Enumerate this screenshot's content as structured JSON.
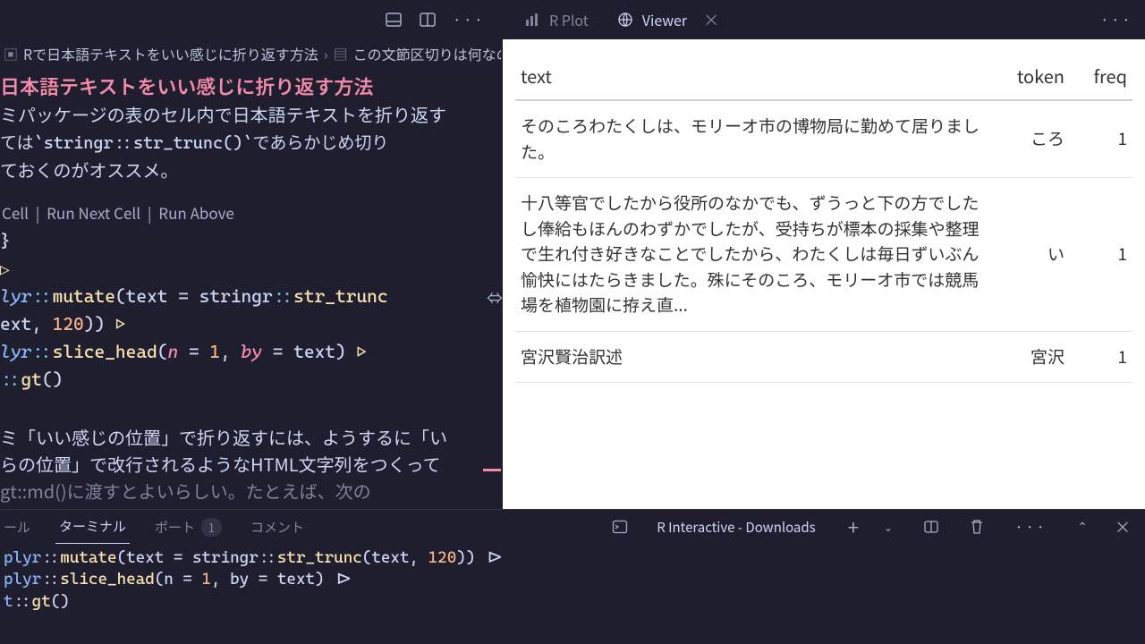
{
  "topbar": {
    "tabs": {
      "rplot": "R Plot",
      "viewer": "Viewer"
    }
  },
  "breadcrumb": {
    "file": "Rで日本語テキストをいい感じに折り返す方法",
    "section": "この文節区切りは何なの"
  },
  "doc": {
    "title": "日本語テキストをいい感じに折り返す方法",
    "p1a": "ミパッケージの表のセル内で日本語テキストを折り返す",
    "p1b": "ては`stringr::str_trunc()`であらかじめ切り",
    "p1c": "ておくのがオススメ。",
    "codelens": {
      "cell": "Cell",
      "next": "Run Next Cell",
      "above": "Run Above"
    },
    "code": {
      "l1": "}",
      "pipe": "▷",
      "l3a": "lyr",
      "l3ns": "::",
      "l3fn": "mutate",
      "l3b": "(text = stringr",
      "l3fn2": "str_trunc",
      "l4a": "ext, ",
      "l4num": "120",
      "l4b": ")) ",
      "l5a": "lyr",
      "l5fn": "slice_head",
      "l5b": "(",
      "l5p1": "n",
      "l5c": " = ",
      "l5n1": "1",
      "l5d": ", ",
      "l5p2": "by",
      "l5e": " = text) ",
      "l6a": "::",
      "l6fn": "gt",
      "l6b": "()"
    },
    "p2a": "ミ「いい感じの位置」で折り返すには、ようするに「い",
    "p2b": "らの位置」で改行されるようなHTML文字列をつくって",
    "p2c": "gt::md()に渡すとよいらしい。たとえば、次の"
  },
  "viewer": {
    "headers": {
      "text": "text",
      "token": "token",
      "freq": "freq"
    },
    "rows": [
      {
        "text": "そのころわたくしは、モリーオ市の博物局に勤めて居りました。",
        "token": "ころ",
        "freq": "1"
      },
      {
        "text": "十八等官でしたから役所のなかでも、ずうっと下の方でしたし俸給もほんのわずかでしたが、受持ちが標本の採集や整理で生れ付き好きなことでしたから、わたくしは毎日ずいぶん愉快にはたらきました。殊にそのころ、モリーオ市では競馬場を植物園に拵え直...",
        "token": "い",
        "freq": "1"
      },
      {
        "text": "宮沢賢治訳述",
        "token": "宮沢",
        "freq": "1"
      }
    ]
  },
  "terminal": {
    "tabs": {
      "debug": "ール",
      "terminal": "ターミナル",
      "ports": "ポート",
      "ports_count": "1",
      "comments": "コメント"
    },
    "session": "R Interactive - Downloads",
    "lines": {
      "l1": "plyr::mutate(text = stringr::str_trunc(text, 120)) |>",
      "l2": "plyr::slice_head(n = 1, by = text) |>",
      "l3": "t::gt()"
    }
  }
}
